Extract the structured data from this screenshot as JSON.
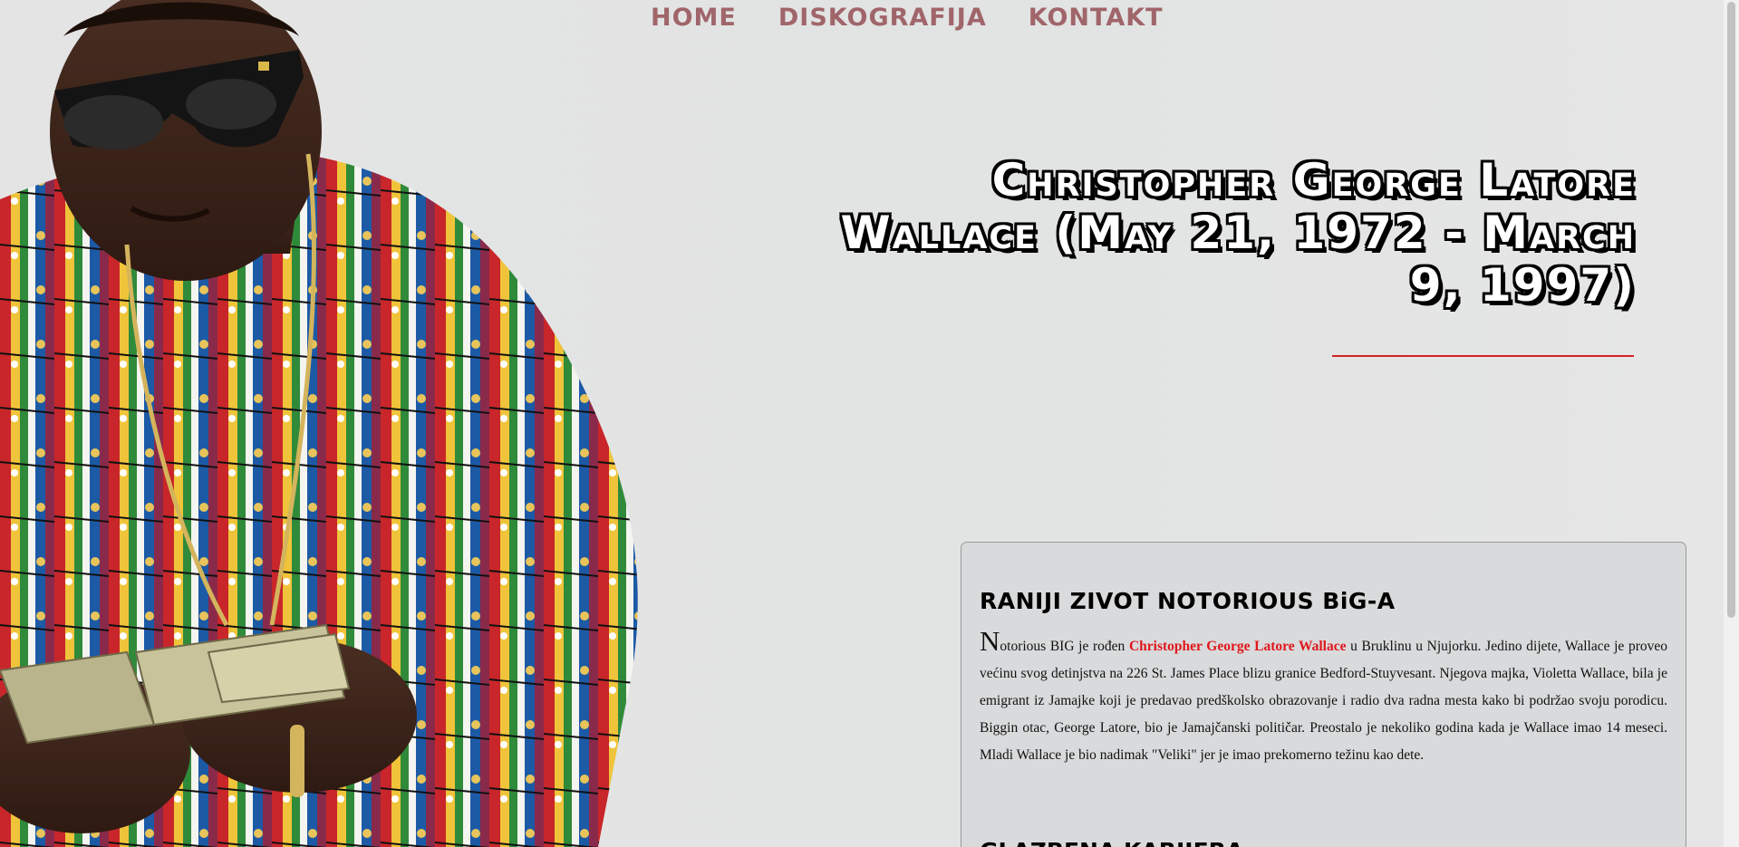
{
  "nav": {
    "items": [
      "HOME",
      "DISKOGRAFIJA",
      "KONTAKT"
    ]
  },
  "hero": {
    "title": "Christopher George Latore Wallace (May 21, 1972 - March 9, 1997)",
    "photo_icon": "person-photo"
  },
  "bio": {
    "heading": "RANIJI ZIVOT NOTORIOUS BiG-A",
    "dropcap": "N",
    "text_before": "otorious BIG je rođen ",
    "highlight": "Christopher George Latore Wallace",
    "text_after": " u Bruklinu u Njujorku. Jedino dijete, Wallace je proveo većinu svog detinjstva na 226 St. James Place blizu granice Bedford-Stuyvesant. Njegova majka, Violetta Wallace, bila je emigrant iz Jamajke koji je predavao predškolsko obrazovanje i radio dva radna mesta kako bi podržao svoju porodicu. Biggin otac, George Latore, bio je Jamajčanski političar. Preostalo je nekoliko godina kada je Wallace imao 14 meseci. Mladi Wallace je bio nadimak \"Veliki\" jer je imao prekomerno težinu kao dete.",
    "next_heading": "GLAZBENA KARIJERA"
  },
  "colors": {
    "nav": "#a0656a",
    "accent_rule": "#d32222",
    "highlight": "#e0161b",
    "background": "#e3e4e4"
  }
}
